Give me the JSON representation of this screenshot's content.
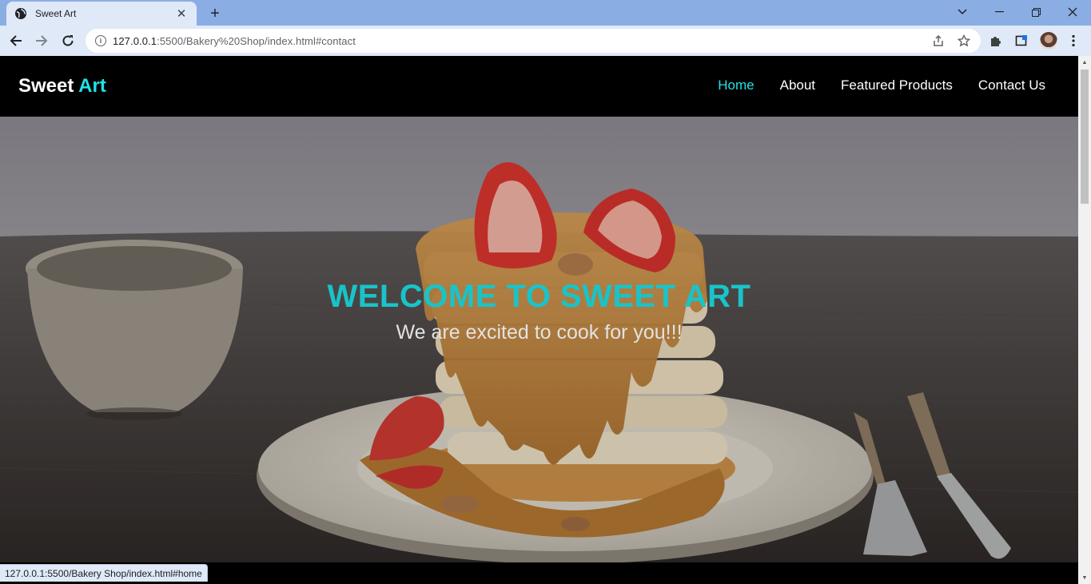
{
  "browser": {
    "tab_title": "Sweet Art",
    "url_host": "127.0.0.1",
    "url_rest": ":5500/Bakery%20Shop/index.html#contact",
    "status_url": "127.0.0.1:5500/Bakery Shop/index.html#home"
  },
  "site": {
    "logo_main": "Sweet",
    "logo_accent": "Art",
    "nav": [
      "Home",
      "About",
      "Featured Products",
      "Contact Us"
    ],
    "active_nav": "Home",
    "accent_color": "#1fe3e8"
  },
  "hero": {
    "title": "WELCOME TO SWEET ART",
    "subtitle": "We are excited to cook for you!!!"
  }
}
